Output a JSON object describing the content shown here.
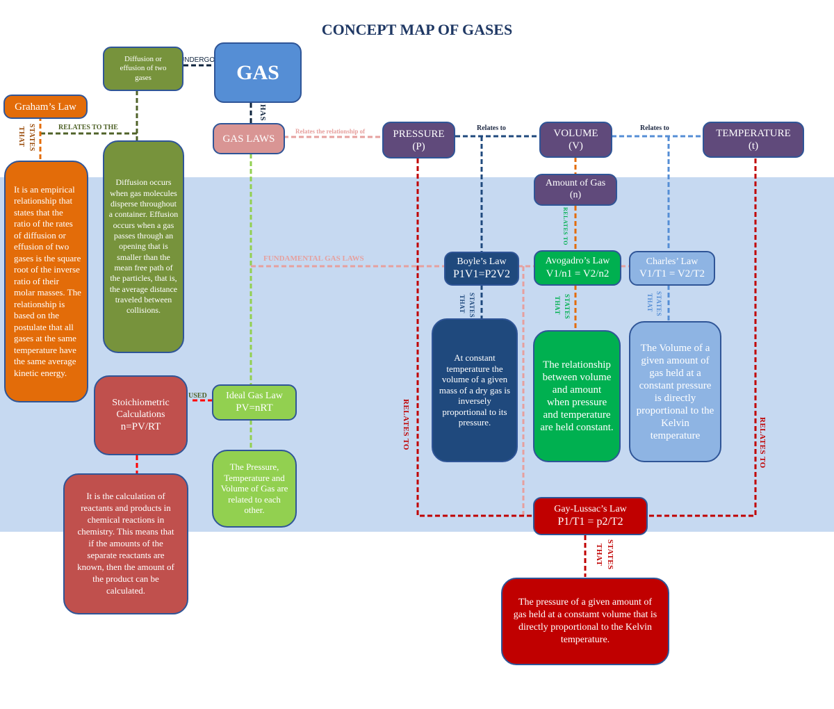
{
  "title": "CONCEPT MAP OF GASES",
  "colors": {
    "band": "#c6d9f1",
    "gas": "#558ed5",
    "gas_laws": "#d99594",
    "variable": "#604a7b",
    "olive": "#77933c",
    "orange": "#e36c09",
    "boyle": "#1f497d",
    "avogadro": "#00b050",
    "charles": "#8eb4e3",
    "ideal": "#92d050",
    "stoich": "#c0504d",
    "gay_lussac": "#c00000"
  },
  "nodes": {
    "gas": "GAS",
    "gas_laws": "GAS LAWS",
    "diffusion_effusion": "Diffusion or effusion of two gases",
    "grahams_law": "Graham’s Law",
    "grahams_desc": "It is an empirical relationship that states that the ratio of the rates of diffusion or effusion of two gases is the square root of the inverse ratio of their molar masses. The relationship is based on the postulate that all gases at the same temperature have the same average kinetic energy.",
    "diffusion_desc": "Diffusion occurs when gas molecules disperse throughout a container. Effusion occurs when a gas passes through an opening that is smaller than the mean free path of the particles, that is, the average distance traveled between collisions.",
    "pressure_line1": "PRESSURE",
    "pressure_line2": "(P)",
    "volume_line1": "VOLUME",
    "volume_line2": "(V)",
    "temperature_line1": "TEMPERATURE",
    "temperature_line2": "(t)",
    "amount_line1": "Amount of Gas",
    "amount_line2": "(n)",
    "boyle_line1": "Boyle’s Law",
    "boyle_line2": "P1V1=P2V2",
    "avogadro_line1": "Avogadro’s Law",
    "avogadro_line2": "V1/n1 = V2/n2",
    "charles_line1": "Charles’ Law",
    "charles_line2": "V1/T1 = V2/T2",
    "boyle_desc": "At constant temperature the volume of a given mass of a dry gas is inversely proportional to its pressure.",
    "avogadro_desc": "The relationship between volume and amount when pressure and temperature are held constant.",
    "charles_desc": "The Volume of a given amount of gas held at a constant pressure is directly proportional to the Kelvin temperature",
    "ideal_line1": "Ideal Gas Law",
    "ideal_line2": "PV=nRT",
    "ideal_desc": "The Pressure, Temperature and Volume of Gas are related to each other.",
    "stoich_line1": "Stoichiometric",
    "stoich_line2": "Calculations",
    "stoich_line3": "n=PV/RT",
    "stoich_desc": "It is the calculation of reactants and products in chemical reactions in chemistry. This means that if the amounts of the separate reactants are known, then the amount of the product can be calculated.",
    "gay_line1": "Gay-Lussac’s Law",
    "gay_line2": "P1/T1 = p2/T2",
    "gay_desc": "The pressure of a given amount of gas held at a constamt volume that is directly proportional to the Kelvin temperature."
  },
  "links": {
    "undergo": "UNDERGO",
    "has": "HAS",
    "relates_to_the": "RELATES TO THE",
    "states_that_graham_1": "STATES",
    "states_that_graham_2": "THAT",
    "relates_relationship": "Relates the relationship of",
    "relates_to_pv": "Relates to",
    "relates_to_vt": "Relates to",
    "fundamental": "FUNDAMENTAL GAS LAWS",
    "relates_to_amount": "RELATES TO",
    "states_1": "STATES",
    "states_2": "THAT",
    "used": "USED",
    "relates_to_left": "RELATES TO",
    "relates_to_right": "RELATES TO"
  }
}
